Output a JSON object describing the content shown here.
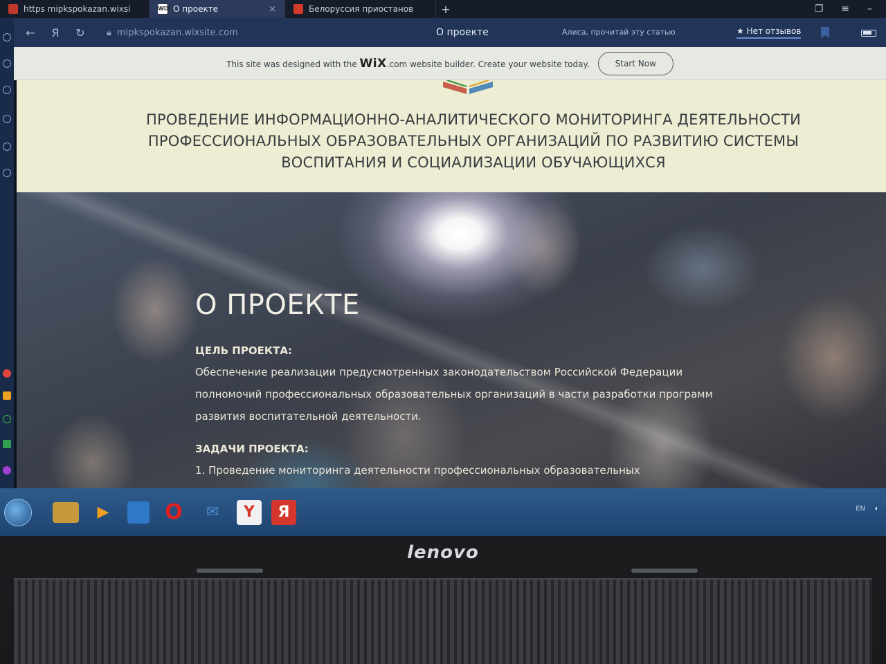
{
  "browser": {
    "tabs": [
      {
        "label": "https mipkspokazan.wixsi"
      },
      {
        "label": "",
        "badge": "WiX"
      },
      {
        "label": "О проекте",
        "close": "×"
      },
      {
        "label": "Белоруссия приостанов"
      }
    ],
    "new_tab": "+",
    "address": {
      "url": "mipkspokazan.wixsite.com",
      "page_title": "О проекте",
      "alice_hint": "Алиса, прочитай эту статью",
      "reviews": "★ Нет отзывов"
    }
  },
  "wix_banner": {
    "text_before": "This site was designed with the",
    "brand": "WiX",
    "text_after": ".com website builder. Create your website today.",
    "button": "Start Now"
  },
  "header": {
    "title": "ПРОВЕДЕНИЕ ИНФОРМАЦИОННО-АНАЛИТИЧЕСКОГО МОНИТОРИНГА ДЕЯТЕЛЬНОСТИ ПРОФЕССИОНАЛЬНЫХ ОБРАЗОВАТЕЛЬНЫХ ОРГАНИЗАЦИЙ ПО РАЗВИТИЮ СИСТЕМЫ ВОСПИТАНИЯ И СОЦИАЛИЗАЦИИ ОБУЧАЮЩИХСЯ"
  },
  "hero": {
    "title": "О ПРОЕКТЕ",
    "goal_label": "ЦЕЛЬ ПРОЕКТА:",
    "goal_text": "Обеспечение реализации предусмотренных законодательством Российской Федерации полномочий профессиональных образовательных организаций в части разработки программ развития воспитательной деятельности.",
    "tasks_label": "ЗАДАЧИ ПРОЕКТА:",
    "task_1": "1. Проведение мониторинга деятельности профессиональных образовательных"
  },
  "taskbar": {
    "apps": [
      "folder-icon",
      "media-icon",
      "save-icon",
      "opera-icon",
      "mail-icon",
      "yandex-y-icon",
      "yandex-browser-icon"
    ],
    "opera_label": "O",
    "yandex_label": "Y",
    "yandex_browser_label": "Я",
    "tray_lang": "EN"
  },
  "bezel": {
    "brand": "lenovo"
  },
  "colors": {
    "header_bg": "#ecedd2",
    "banner_bg": "#e6e8e2",
    "address_bar": "#223457",
    "taskbar": "#1f4470",
    "opera_red": "#e02020",
    "yandex_red": "#d4362b"
  }
}
